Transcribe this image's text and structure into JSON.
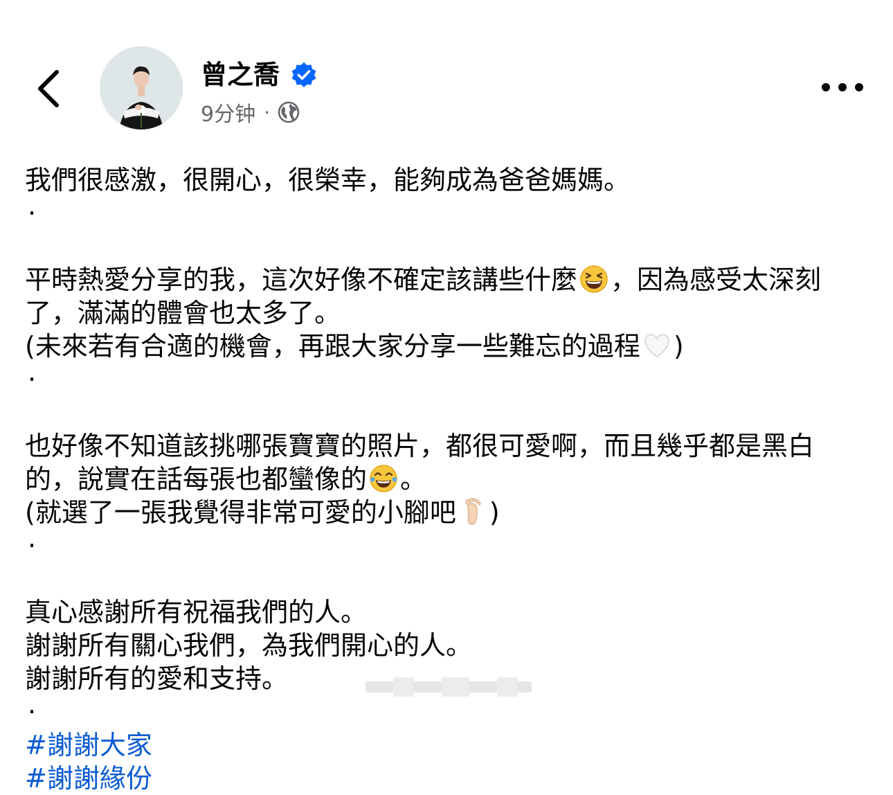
{
  "header": {
    "author_name": "曾之喬",
    "timestamp": "9分钟",
    "separator": "·",
    "privacy_icon": "globe-icon",
    "verified_icon": "verified-badge-icon",
    "back_icon": "chevron-left-icon",
    "more_icon": "more-options-icon"
  },
  "post": {
    "lines": [
      "我們很感激，很開心，很榮幸，能夠成為爸爸媽媽。",
      "·",
      "平時熱愛分享的我，這次好像不確定該講些什麼",
      "，因為感受太深刻",
      "了，滿滿的體會也太多了。",
      "(未來若有合適的機會，再跟大家分享一些難忘的過程",
      ")",
      "·",
      "也好像不知道該挑哪張寶寶的照片，都很可愛啊，而且幾乎都是黑白",
      "的，說實在話每張也都蠻像的",
      "。",
      "(就選了一張我覺得非常可愛的小腳吧",
      ")",
      "·",
      "真心感謝所有祝福我們的人。",
      "謝謝所有關心我們，為我們開心的人。",
      "謝謝所有的愛和支持。",
      "·"
    ],
    "hashtags": [
      "#謝謝大家",
      "#謝謝緣份"
    ],
    "emojis": [
      "laughing-emoji",
      "white-heart-emoji",
      "tears-of-joy-emoji",
      "foot-emoji"
    ]
  },
  "colors": {
    "text": "#050505",
    "secondary": "#65676b",
    "hashtag": "#0b5bd4",
    "verified": "#0866ff"
  }
}
